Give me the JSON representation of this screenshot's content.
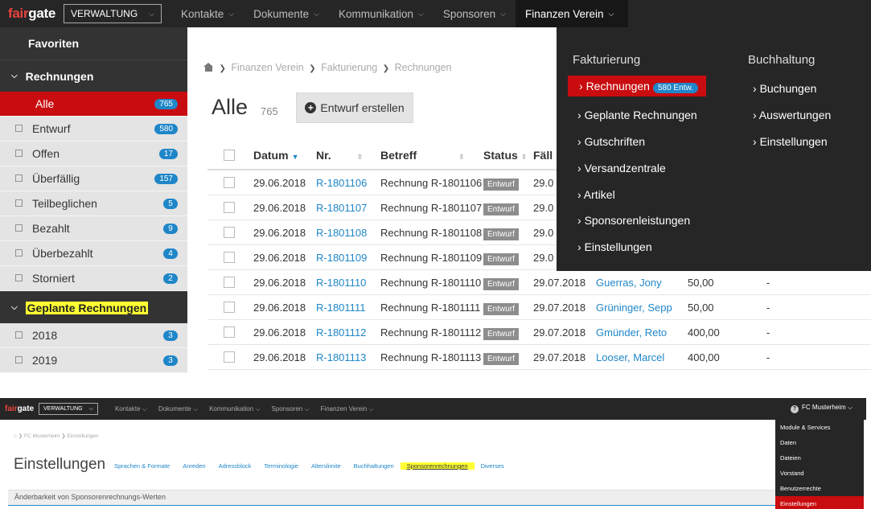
{
  "top": {
    "logo": {
      "fair": "fair",
      "gate": "gate"
    },
    "module": "VERWALTUNG",
    "nav": [
      "Kontakte",
      "Dokumente",
      "Kommunikation",
      "Sponsoren",
      "Finanzen Verein"
    ],
    "sidebar": {
      "favorites": "Favoriten",
      "section1": "Rechnungen",
      "items": [
        {
          "label": "Alle",
          "count": "765"
        },
        {
          "label": "Entwurf",
          "count": "580"
        },
        {
          "label": "Offen",
          "count": "17"
        },
        {
          "label": "Überfällig",
          "count": "157"
        },
        {
          "label": "Teilbeglichen",
          "count": "5"
        },
        {
          "label": "Bezahlt",
          "count": "9"
        },
        {
          "label": "Überbezahlt",
          "count": "4"
        },
        {
          "label": "Storniert",
          "count": "2"
        }
      ],
      "section2": "Geplante Rechnungen",
      "years": [
        {
          "label": "2018",
          "count": "3"
        },
        {
          "label": "2019",
          "count": "3"
        }
      ]
    },
    "breadcrumb": [
      "Finanzen Verein",
      "Fakturierung",
      "Rechnungen"
    ],
    "title": "Alle",
    "count": "765",
    "create_button": "Entwurf erstellen",
    "table": {
      "headers": [
        "Datum",
        "Nr.",
        "Betreff",
        "Status",
        "Fäll"
      ],
      "rows": [
        {
          "datum": "29.06.2018",
          "nr": "R-1801106",
          "betreff": "Rechnung R-1801106",
          "status": "Entwurf",
          "faellig": "29.0",
          "name": "",
          "betrag": "",
          "last": ""
        },
        {
          "datum": "29.06.2018",
          "nr": "R-1801107",
          "betreff": "Rechnung R-1801107",
          "status": "Entwurf",
          "faellig": "29.0",
          "name": "",
          "betrag": "",
          "last": ""
        },
        {
          "datum": "29.06.2018",
          "nr": "R-1801108",
          "betreff": "Rechnung R-1801108",
          "status": "Entwurf",
          "faellig": "29.0",
          "name": "",
          "betrag": "",
          "last": ""
        },
        {
          "datum": "29.06.2018",
          "nr": "R-1801109",
          "betreff": "Rechnung R-1801109",
          "status": "Entwurf",
          "faellig": "29.0",
          "name": "",
          "betrag": "",
          "last": ""
        },
        {
          "datum": "29.06.2018",
          "nr": "R-1801110",
          "betreff": "Rechnung R-1801110",
          "status": "Entwurf",
          "faellig": "29.07.2018",
          "name": "Guerras, Jony",
          "betrag": "50,00",
          "last": "-"
        },
        {
          "datum": "29.06.2018",
          "nr": "R-1801111",
          "betreff": "Rechnung R-1801111",
          "status": "Entwurf",
          "faellig": "29.07.2018",
          "name": "Grüninger, Sepp",
          "betrag": "50,00",
          "last": "-"
        },
        {
          "datum": "29.06.2018",
          "nr": "R-1801112",
          "betreff": "Rechnung R-1801112",
          "status": "Entwurf",
          "faellig": "29.07.2018",
          "name": "Gmünder, Reto",
          "betrag": "400,00",
          "last": "-"
        },
        {
          "datum": "29.06.2018",
          "nr": "R-1801113",
          "betreff": "Rechnung R-1801113",
          "status": "Entwurf",
          "faellig": "29.07.2018",
          "name": "Looser, Marcel",
          "betrag": "400,00",
          "last": "-"
        }
      ]
    },
    "dropdown": {
      "col1_title": "Fakturierung",
      "col1": [
        "Rechnungen",
        "Geplante Rechnungen",
        "Gutschriften",
        "Versandzentrale",
        "Artikel",
        "Sponsorenleistungen",
        "Einstellungen"
      ],
      "active_badge": "580 Entw.",
      "col2_title": "Buchhaltung",
      "col2": [
        "Buchungen",
        "Auswertungen",
        "Einstellungen"
      ]
    }
  },
  "bottom": {
    "logo": {
      "fair": "fair",
      "gate": "gate"
    },
    "module": "VERWALTUNG",
    "nav": [
      "Kontakte",
      "Dokumente",
      "Kommunikation",
      "Sponsoren",
      "Finanzen Verein"
    ],
    "club": "FC Musterheim",
    "breadcrumb": [
      "FC Musterheim",
      "Einstellungen"
    ],
    "title": "Einstellungen",
    "tabs": [
      "Sprachen & Formate",
      "Anreden",
      "Adressblock",
      "Terminologie",
      "Alterslimite",
      "Buchhaltungen",
      "Sponsorenrechnungen",
      "Diverses"
    ],
    "section": "Änderbarkeit von Sponsorenrechnungs-Werten",
    "menu": [
      "Module & Services",
      "Daten",
      "Dateien",
      "Vorstand",
      "Benutzerrechte",
      "Einstellungen"
    ]
  },
  "colors": {
    "accent": "#c90c0f",
    "link": "#1f86c8",
    "dark": "#262626",
    "highlight": "#ffff33"
  }
}
